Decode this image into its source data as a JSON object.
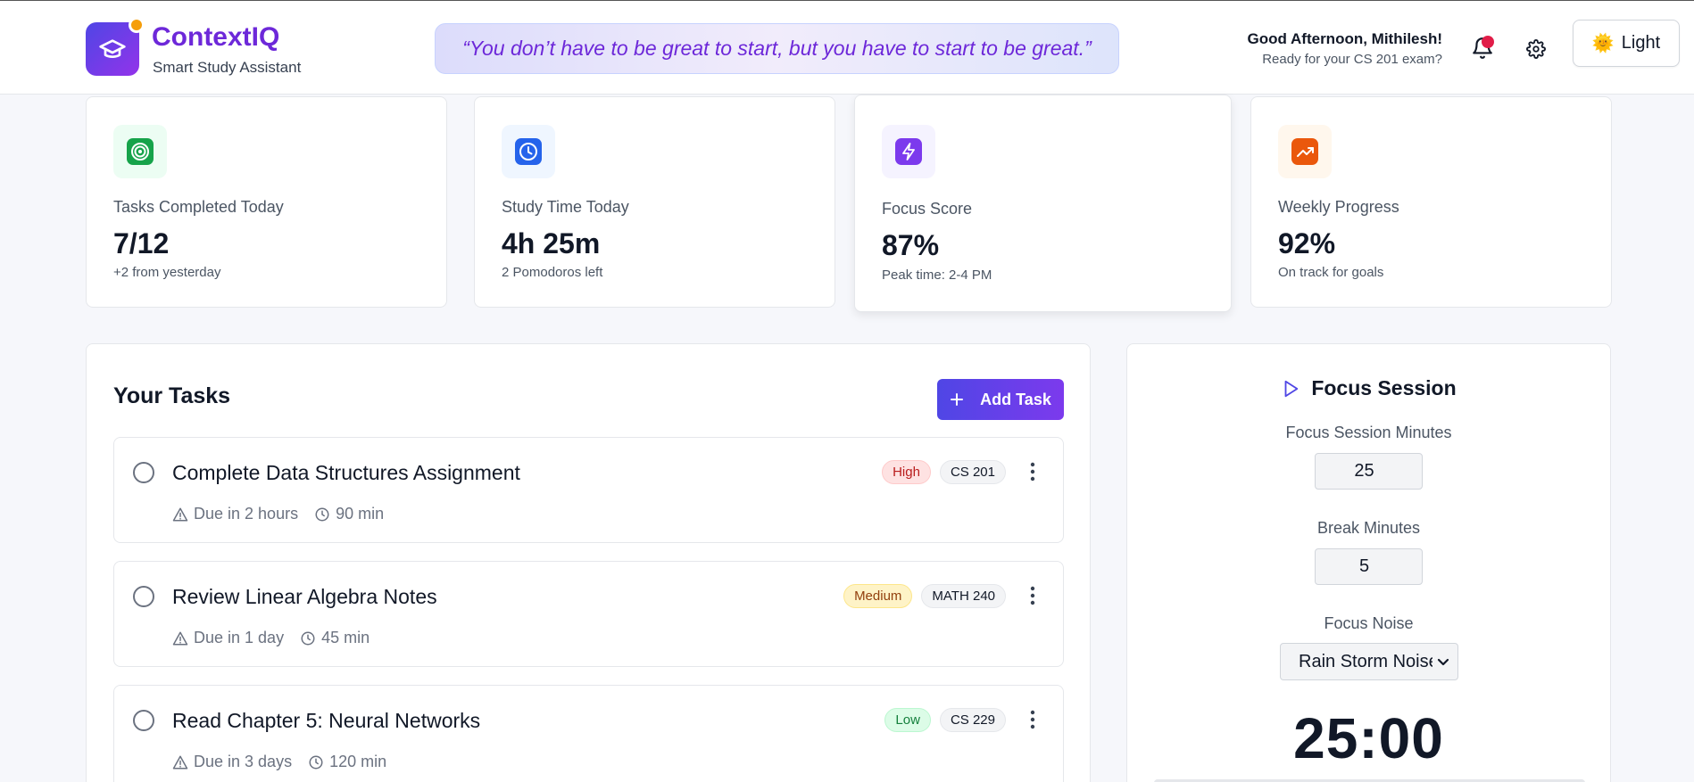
{
  "header": {
    "brand_name": "ContextIQ",
    "brand_subtitle": "Smart Study Assistant",
    "quote": "“You don’t have to be great to start, but you have to start to be great.”",
    "greeting": "Good Afternoon, Mithilesh!",
    "greeting_sub": "Ready for your CS 201 exam?",
    "theme_toggle_label": "Light",
    "theme_icon": "🌞"
  },
  "stats": [
    {
      "label": "Tasks Completed Today",
      "value": "7/12",
      "note": "+2 from yesterday",
      "icon": "target-icon",
      "color": "#16a34a"
    },
    {
      "label": "Study Time Today",
      "value": "4h 25m",
      "note": "2 Pomodoros left",
      "icon": "clock-icon",
      "color": "#2563eb"
    },
    {
      "label": "Focus Score",
      "value": "87%",
      "note": "Peak time: 2-4 PM",
      "icon": "lightning-icon",
      "color": "#7c3aed"
    },
    {
      "label": "Weekly Progress",
      "value": "92%",
      "note": "On track for goals",
      "icon": "trending-up-icon",
      "color": "#ea580c"
    }
  ],
  "tasks_panel": {
    "title": "Your Tasks",
    "add_button_label": "Add Task",
    "tasks": [
      {
        "title": "Complete Data Structures Assignment",
        "priority": "High",
        "course": "CS 201",
        "due": "Due in 2 hours",
        "duration": "90 min"
      },
      {
        "title": "Review Linear Algebra Notes",
        "priority": "Medium",
        "course": "MATH 240",
        "due": "Due in 1 day",
        "duration": "45 min"
      },
      {
        "title": "Read Chapter 5: Neural Networks",
        "priority": "Low",
        "course": "CS 229",
        "due": "Due in 3 days",
        "duration": "120 min"
      }
    ]
  },
  "focus": {
    "title": "Focus Session",
    "minutes_label": "Focus Session Minutes",
    "minutes_value": "25",
    "break_label": "Break Minutes",
    "break_value": "5",
    "noise_label": "Focus Noise",
    "noise_value": "Rain Storm Noise",
    "timer": "25:00"
  },
  "colors": {
    "accent": "#6d28d9",
    "accent_gradient_start": "#4f46e5",
    "notification": "#e11d48"
  }
}
